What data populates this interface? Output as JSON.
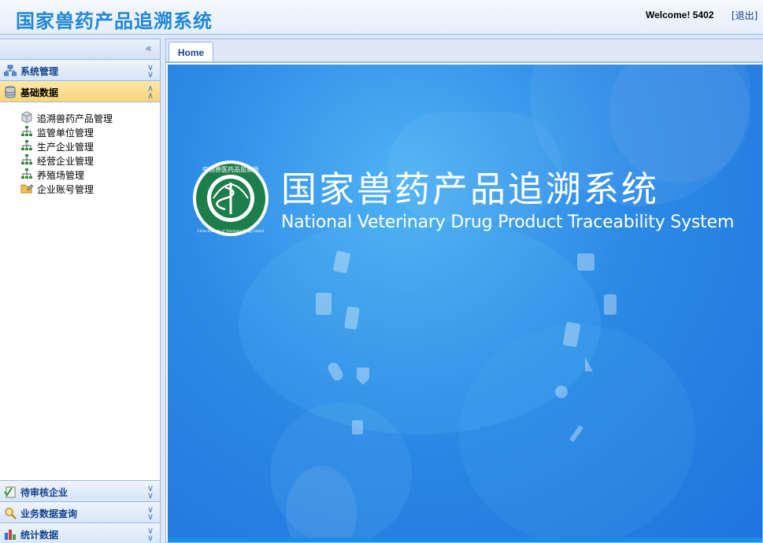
{
  "header": {
    "app_title": "国家兽药产品追溯系统",
    "welcome": "Welcome! 5402",
    "logout": "[退出]"
  },
  "sidebar": {
    "sections_top": [
      {
        "label": "系统管理",
        "icon": "hierarchy-icon",
        "expanded": false
      },
      {
        "label": "基础数据",
        "icon": "database-icon",
        "expanded": true
      }
    ],
    "items": [
      {
        "label": "追溯兽药产品管理",
        "icon": "cube-icon"
      },
      {
        "label": "监管单位管理",
        "icon": "org-tree-icon"
      },
      {
        "label": "生产企业管理",
        "icon": "org-tree-icon"
      },
      {
        "label": "经营企业管理",
        "icon": "org-tree-icon"
      },
      {
        "label": "养殖场管理",
        "icon": "org-tree-icon"
      },
      {
        "label": "企业账号管理",
        "icon": "folder-edit-icon"
      }
    ],
    "sections_bottom": [
      {
        "label": "待审核企业",
        "icon": "checklist-icon"
      },
      {
        "label": "业务数据查询",
        "icon": "magnifier-icon"
      },
      {
        "label": "统计数据",
        "icon": "bar-chart-icon"
      }
    ]
  },
  "tabs": [
    {
      "label": "Home",
      "active": true
    }
  ],
  "banner": {
    "title_cn": "国家兽药产品追溯系统",
    "title_en": "National Veterinary Drug Product Traceability System",
    "emblem": "中国兽医药品监察所 China Institute of Veterinary Drug Control"
  },
  "colors": {
    "accent": "#1f87d8",
    "banner_blue": "#2c8ae6",
    "active_section": "#f9d57a",
    "border": "#99bbe8"
  }
}
